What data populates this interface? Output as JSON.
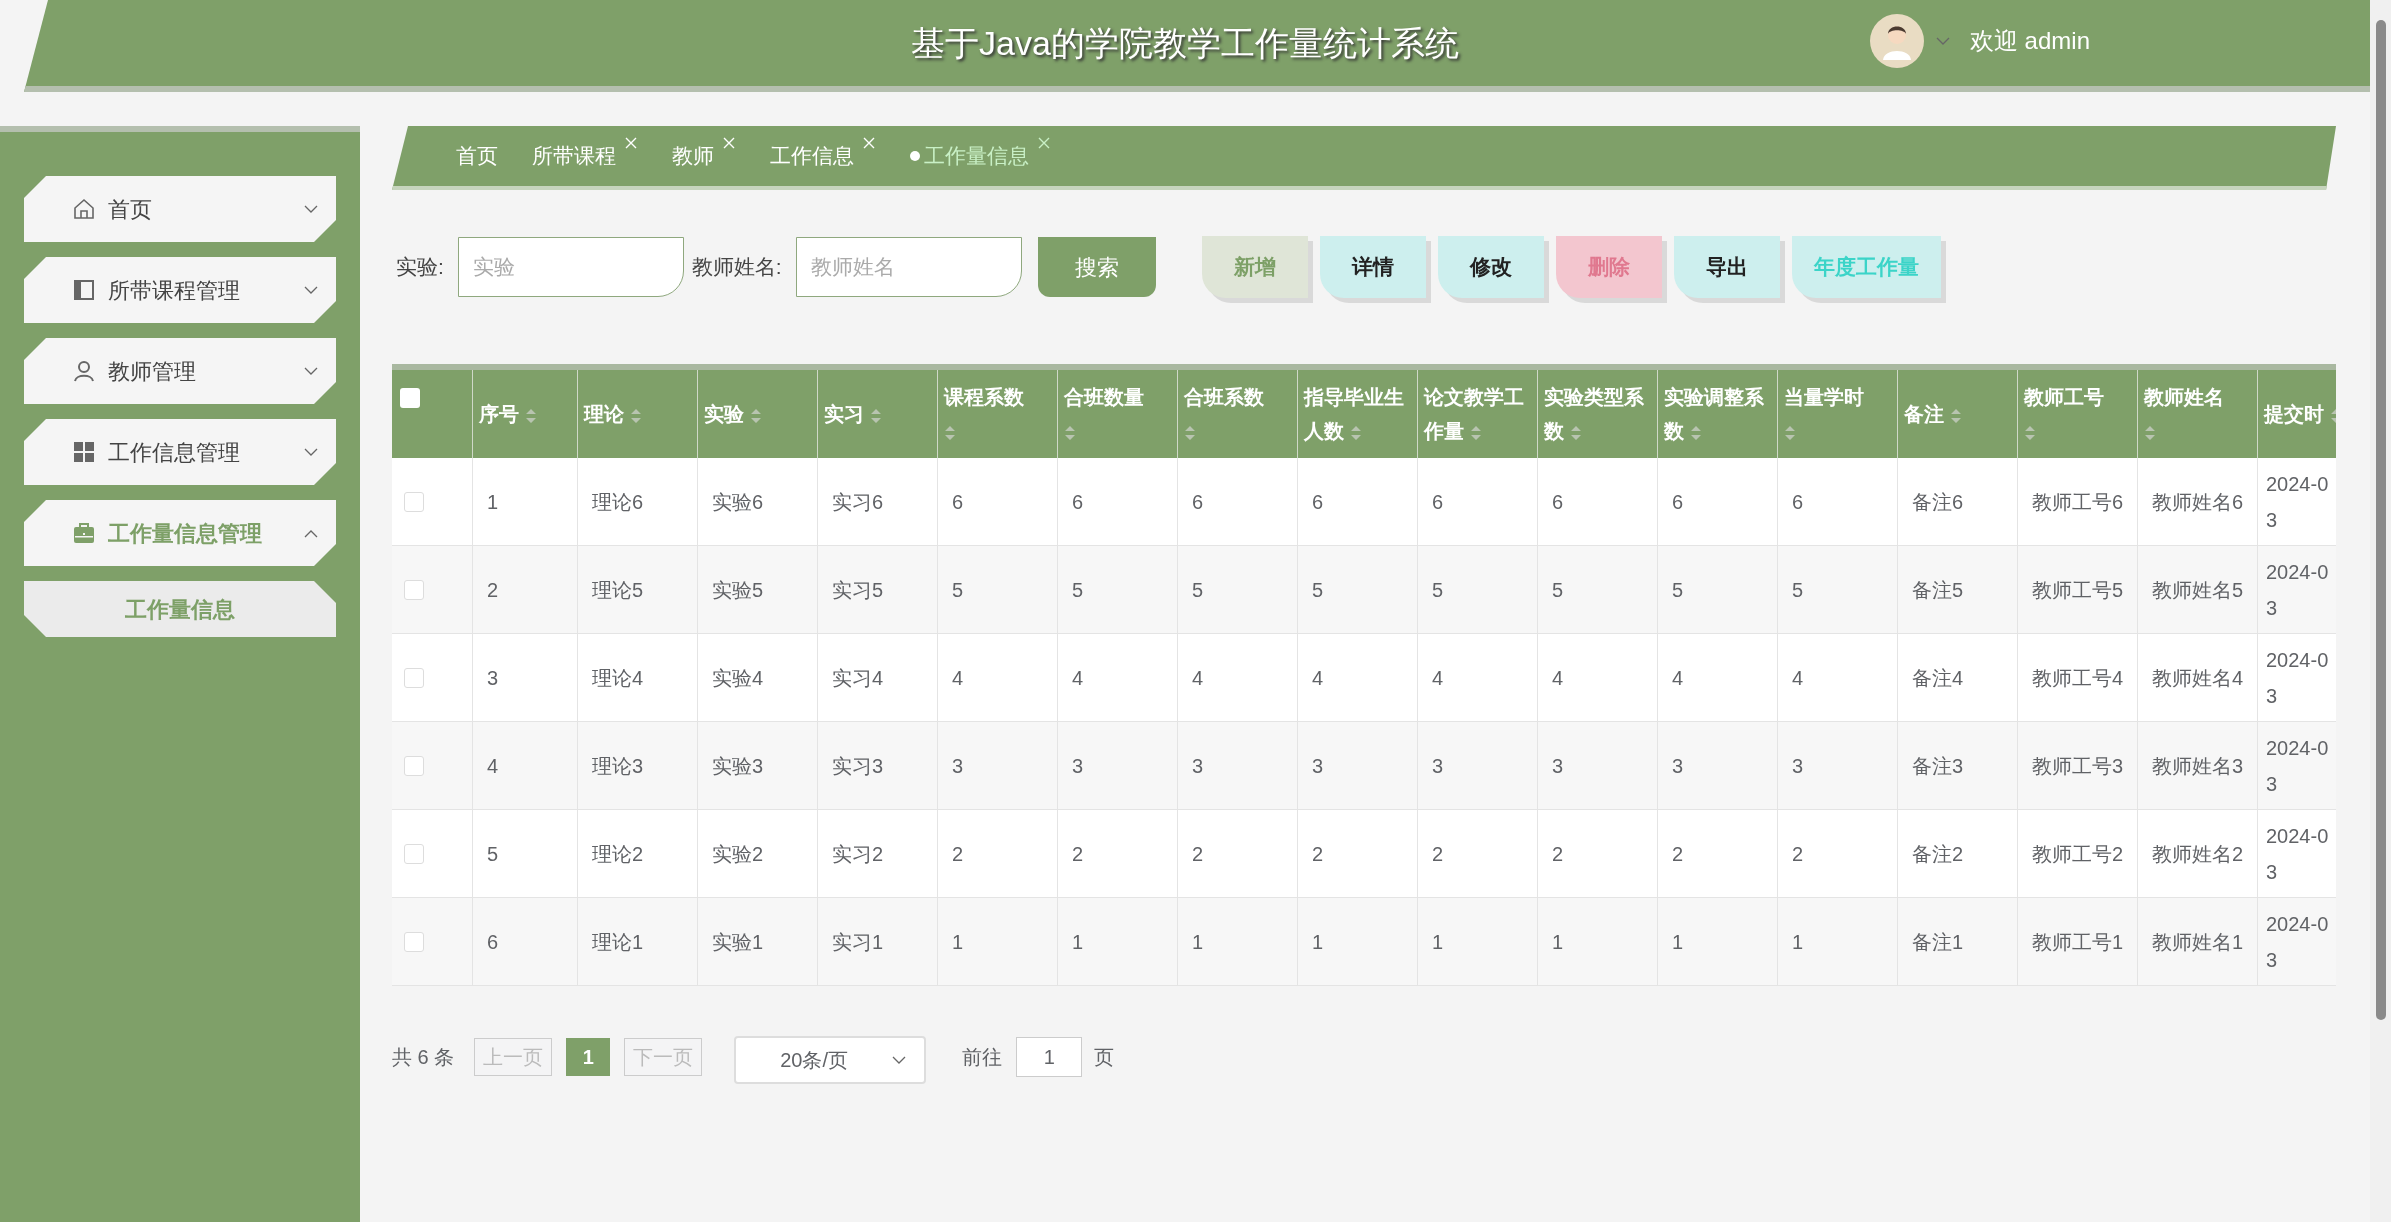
{
  "header": {
    "title": "基于Java的学院教学工作量统计系统",
    "welcome": "欢迎 admin"
  },
  "sidebar": {
    "items": [
      {
        "label": "首页",
        "selected": false,
        "expanded": false
      },
      {
        "label": "所带课程管理",
        "selected": false,
        "expanded": false
      },
      {
        "label": "教师管理",
        "selected": false,
        "expanded": false
      },
      {
        "label": "工作信息管理",
        "selected": false,
        "expanded": false
      },
      {
        "label": "工作量信息管理",
        "selected": true,
        "expanded": true,
        "children": [
          {
            "label": "工作量信息",
            "selected": true
          }
        ]
      }
    ]
  },
  "tabs": [
    {
      "label": "首页",
      "selected": false,
      "closable": false
    },
    {
      "label": "所带课程",
      "selected": false,
      "closable": true
    },
    {
      "label": "教师",
      "selected": false,
      "closable": true
    },
    {
      "label": "工作信息",
      "selected": false,
      "closable": true
    },
    {
      "label": "工作量信息",
      "selected": true,
      "closable": true
    }
  ],
  "search": {
    "fields": [
      {
        "label": "实验:",
        "placeholder": "实验"
      },
      {
        "label": "教师姓名:",
        "placeholder": "教师姓名"
      }
    ],
    "button": "搜索"
  },
  "actions": [
    {
      "label": "新增",
      "kind": "add"
    },
    {
      "label": "详情",
      "kind": "detail"
    },
    {
      "label": "修改",
      "kind": "edit"
    },
    {
      "label": "删除",
      "kind": "delete"
    },
    {
      "label": "导出",
      "kind": "export"
    },
    {
      "label": "年度工作量",
      "kind": "yearly"
    }
  ],
  "table": {
    "all_checked": false,
    "columns": [
      "序号",
      "理论",
      "实验",
      "实习",
      "课程系数",
      "合班数量",
      "合班系数",
      "指导毕业生人数",
      "论文教学工作量",
      "实验类型系数",
      "实验调整系数",
      "当量学时",
      "备注",
      "教师工号",
      "教师姓名",
      "提交时"
    ],
    "rows": [
      {
        "checked": false,
        "cells": [
          "1",
          "理论6",
          "实验6",
          "实习6",
          "6",
          "6",
          "6",
          "6",
          "6",
          "6",
          "6",
          "6",
          "备注6",
          "教师工号6",
          "教师姓名6",
          "2024-0\n3"
        ]
      },
      {
        "checked": false,
        "cells": [
          "2",
          "理论5",
          "实验5",
          "实习5",
          "5",
          "5",
          "5",
          "5",
          "5",
          "5",
          "5",
          "5",
          "备注5",
          "教师工号5",
          "教师姓名5",
          "2024-0\n3"
        ]
      },
      {
        "checked": false,
        "cells": [
          "3",
          "理论4",
          "实验4",
          "实习4",
          "4",
          "4",
          "4",
          "4",
          "4",
          "4",
          "4",
          "4",
          "备注4",
          "教师工号4",
          "教师姓名4",
          "2024-0\n3"
        ]
      },
      {
        "checked": false,
        "cells": [
          "4",
          "理论3",
          "实验3",
          "实习3",
          "3",
          "3",
          "3",
          "3",
          "3",
          "3",
          "3",
          "3",
          "备注3",
          "教师工号3",
          "教师姓名3",
          "2024-0\n3"
        ]
      },
      {
        "checked": false,
        "cells": [
          "5",
          "理论2",
          "实验2",
          "实习2",
          "2",
          "2",
          "2",
          "2",
          "2",
          "2",
          "2",
          "2",
          "备注2",
          "教师工号2",
          "教师姓名2",
          "2024-0\n3"
        ]
      },
      {
        "checked": false,
        "cells": [
          "6",
          "理论1",
          "实验1",
          "实习1",
          "1",
          "1",
          "1",
          "1",
          "1",
          "1",
          "1",
          "1",
          "备注1",
          "教师工号1",
          "教师姓名1",
          "2024-0\n3"
        ]
      }
    ]
  },
  "pagination": {
    "total": "共 6 条",
    "prev": "上一页",
    "pages": [
      {
        "label": "1",
        "selected": true
      }
    ],
    "next": "下一页",
    "page_size": "20条/页",
    "goto_label": "前往",
    "goto_value": "1",
    "goto_suffix": "页"
  }
}
